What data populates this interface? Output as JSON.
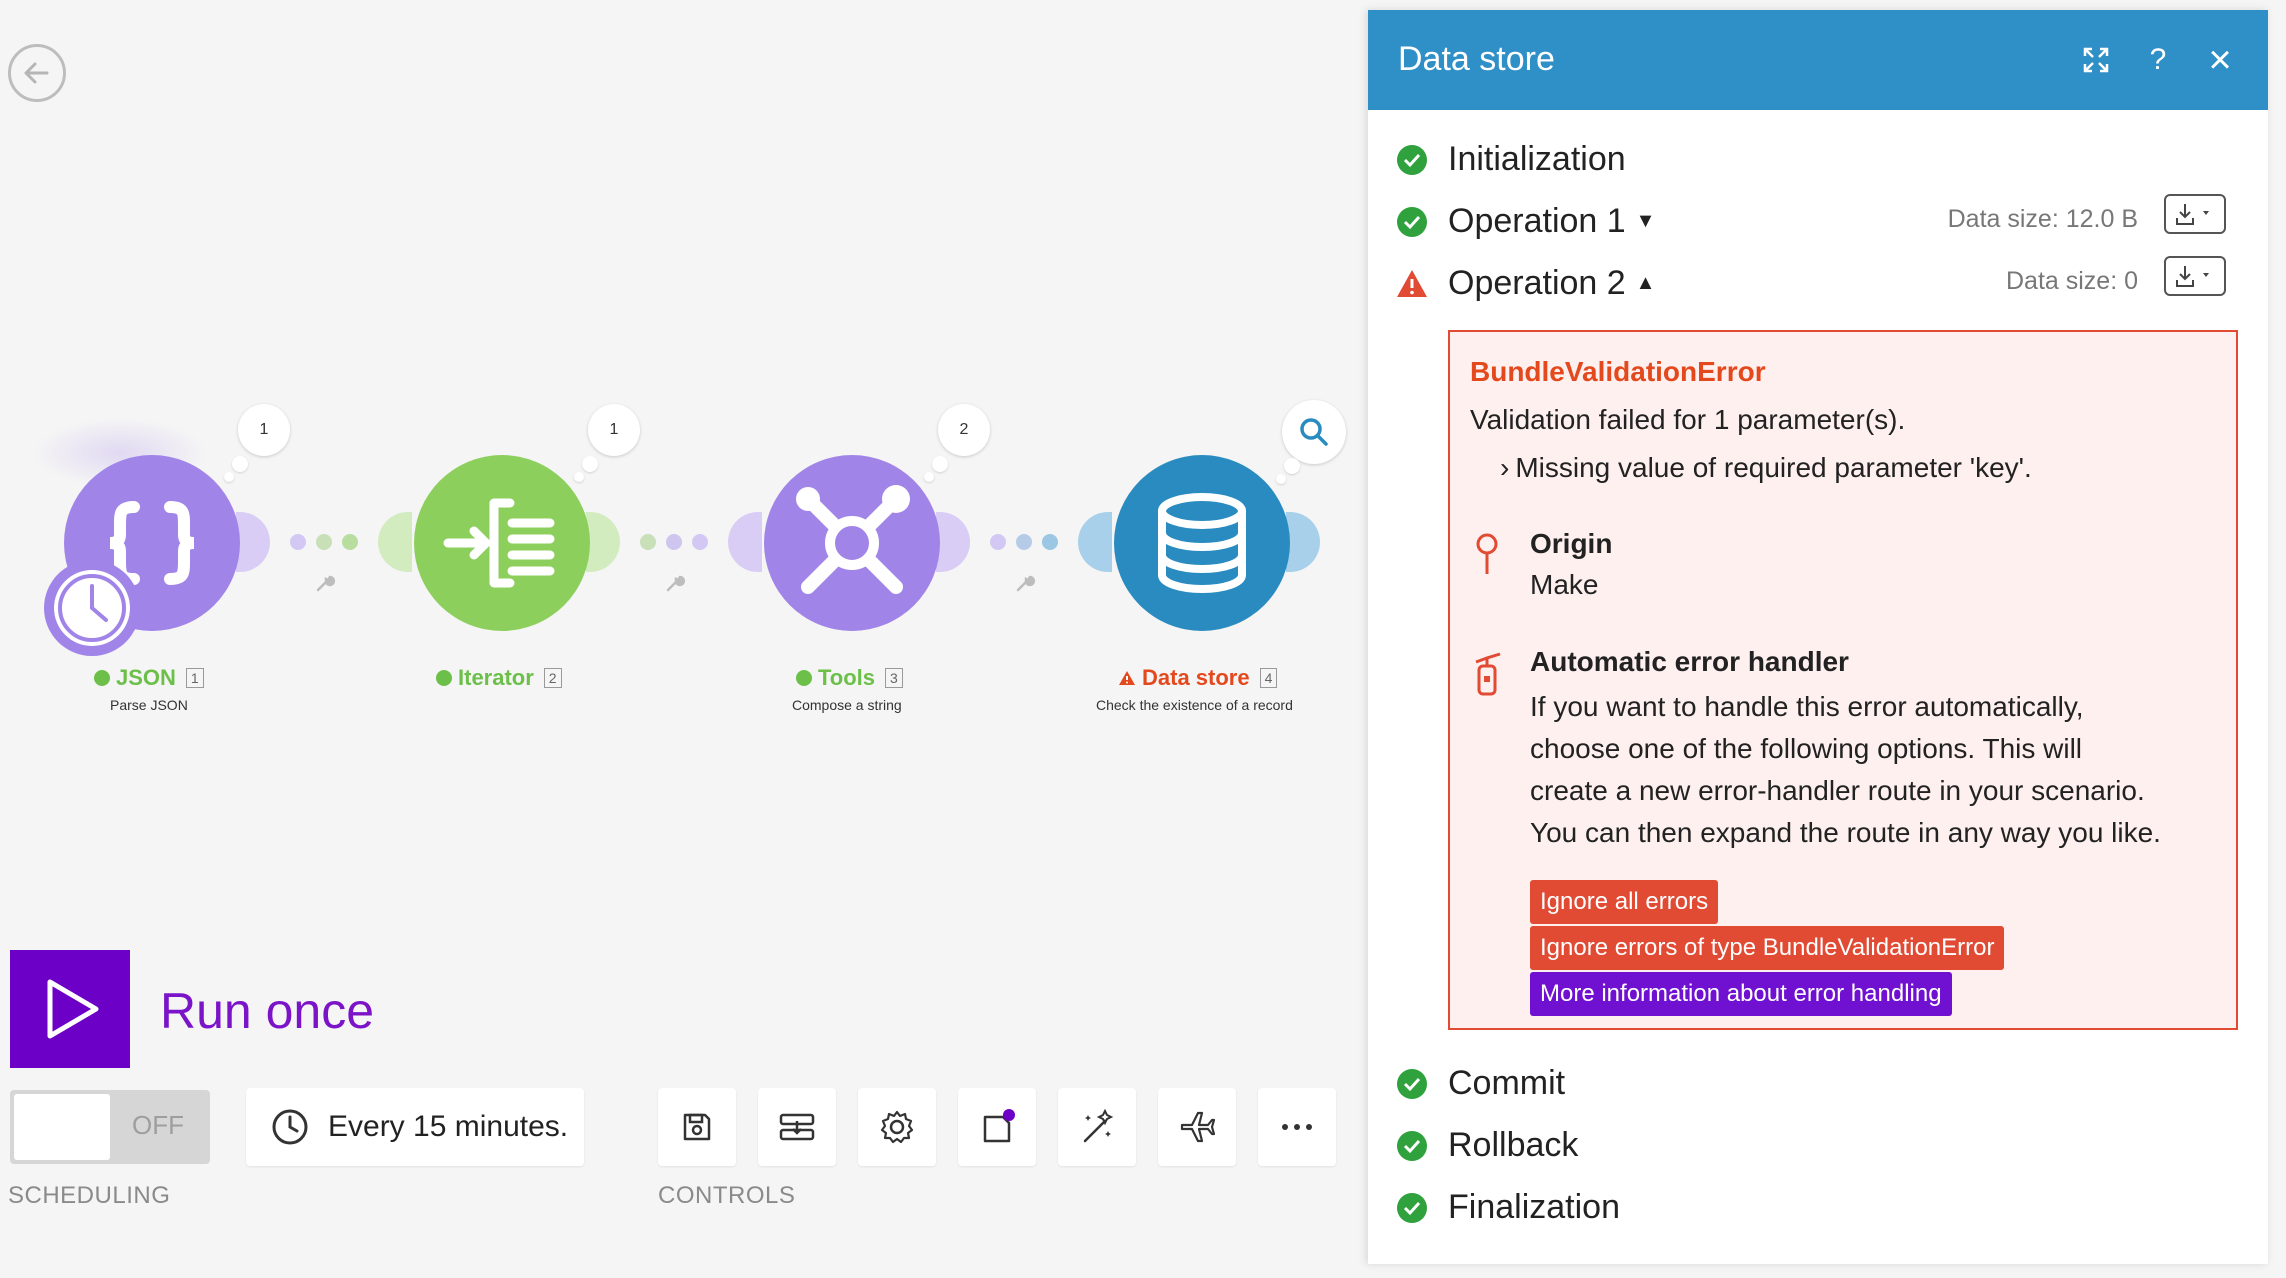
{
  "canvas": {
    "modules": [
      {
        "name": "JSON",
        "number": "1",
        "subtitle": "Parse JSON",
        "bubble": "1",
        "status": "ok",
        "color": "#a184e8"
      },
      {
        "name": "Iterator",
        "number": "2",
        "subtitle": "",
        "bubble": "1",
        "status": "ok",
        "color": "#8dcf5d"
      },
      {
        "name": "Tools",
        "number": "3",
        "subtitle": "Compose a string",
        "bubble": "2",
        "status": "ok",
        "color": "#a184e8"
      },
      {
        "name": "Data store",
        "number": "4",
        "subtitle": "Check the existence of a record",
        "bubble": "",
        "status": "error",
        "color": "#2a8bc0"
      }
    ]
  },
  "bottom": {
    "run_label": "Run once",
    "toggle_state": "OFF",
    "schedule_text": "Every 15 minutes.",
    "scheduling_label": "SCHEDULING",
    "controls_label": "CONTROLS"
  },
  "panel": {
    "title": "Data store",
    "help_icon": "?",
    "close_icon": "×",
    "steps": {
      "initialization": "Initialization",
      "operation1": "Operation 1",
      "operation1_size": "Data size: 12.0 B",
      "operation2": "Operation 2",
      "operation2_size": "Data size: 0",
      "commit": "Commit",
      "rollback": "Rollback",
      "finalization": "Finalization"
    },
    "error": {
      "title": "BundleValidationError",
      "message": "Validation failed for 1 parameter(s).",
      "detail": "Missing value of required parameter 'key'.",
      "origin_label": "Origin",
      "origin_value": "Make",
      "handler_label": "Automatic error handler",
      "handler_text_1": "If you want to handle this error automatically,",
      "handler_text_2": "choose one of the following options. This will",
      "handler_text_3": "create a new error-handler route in your scenario.",
      "handler_text_4": "You can then expand the route in any way you like.",
      "btn_ignore_all": "Ignore all errors",
      "btn_ignore_type": "Ignore errors of type BundleValidationError",
      "btn_more_info": "More information about error handling"
    }
  },
  "colors": {
    "header": "#2f8fc7",
    "success": "#2fa13d",
    "error": "#e14a33",
    "run": "#6c00c6",
    "info_button": "#7010d1"
  }
}
